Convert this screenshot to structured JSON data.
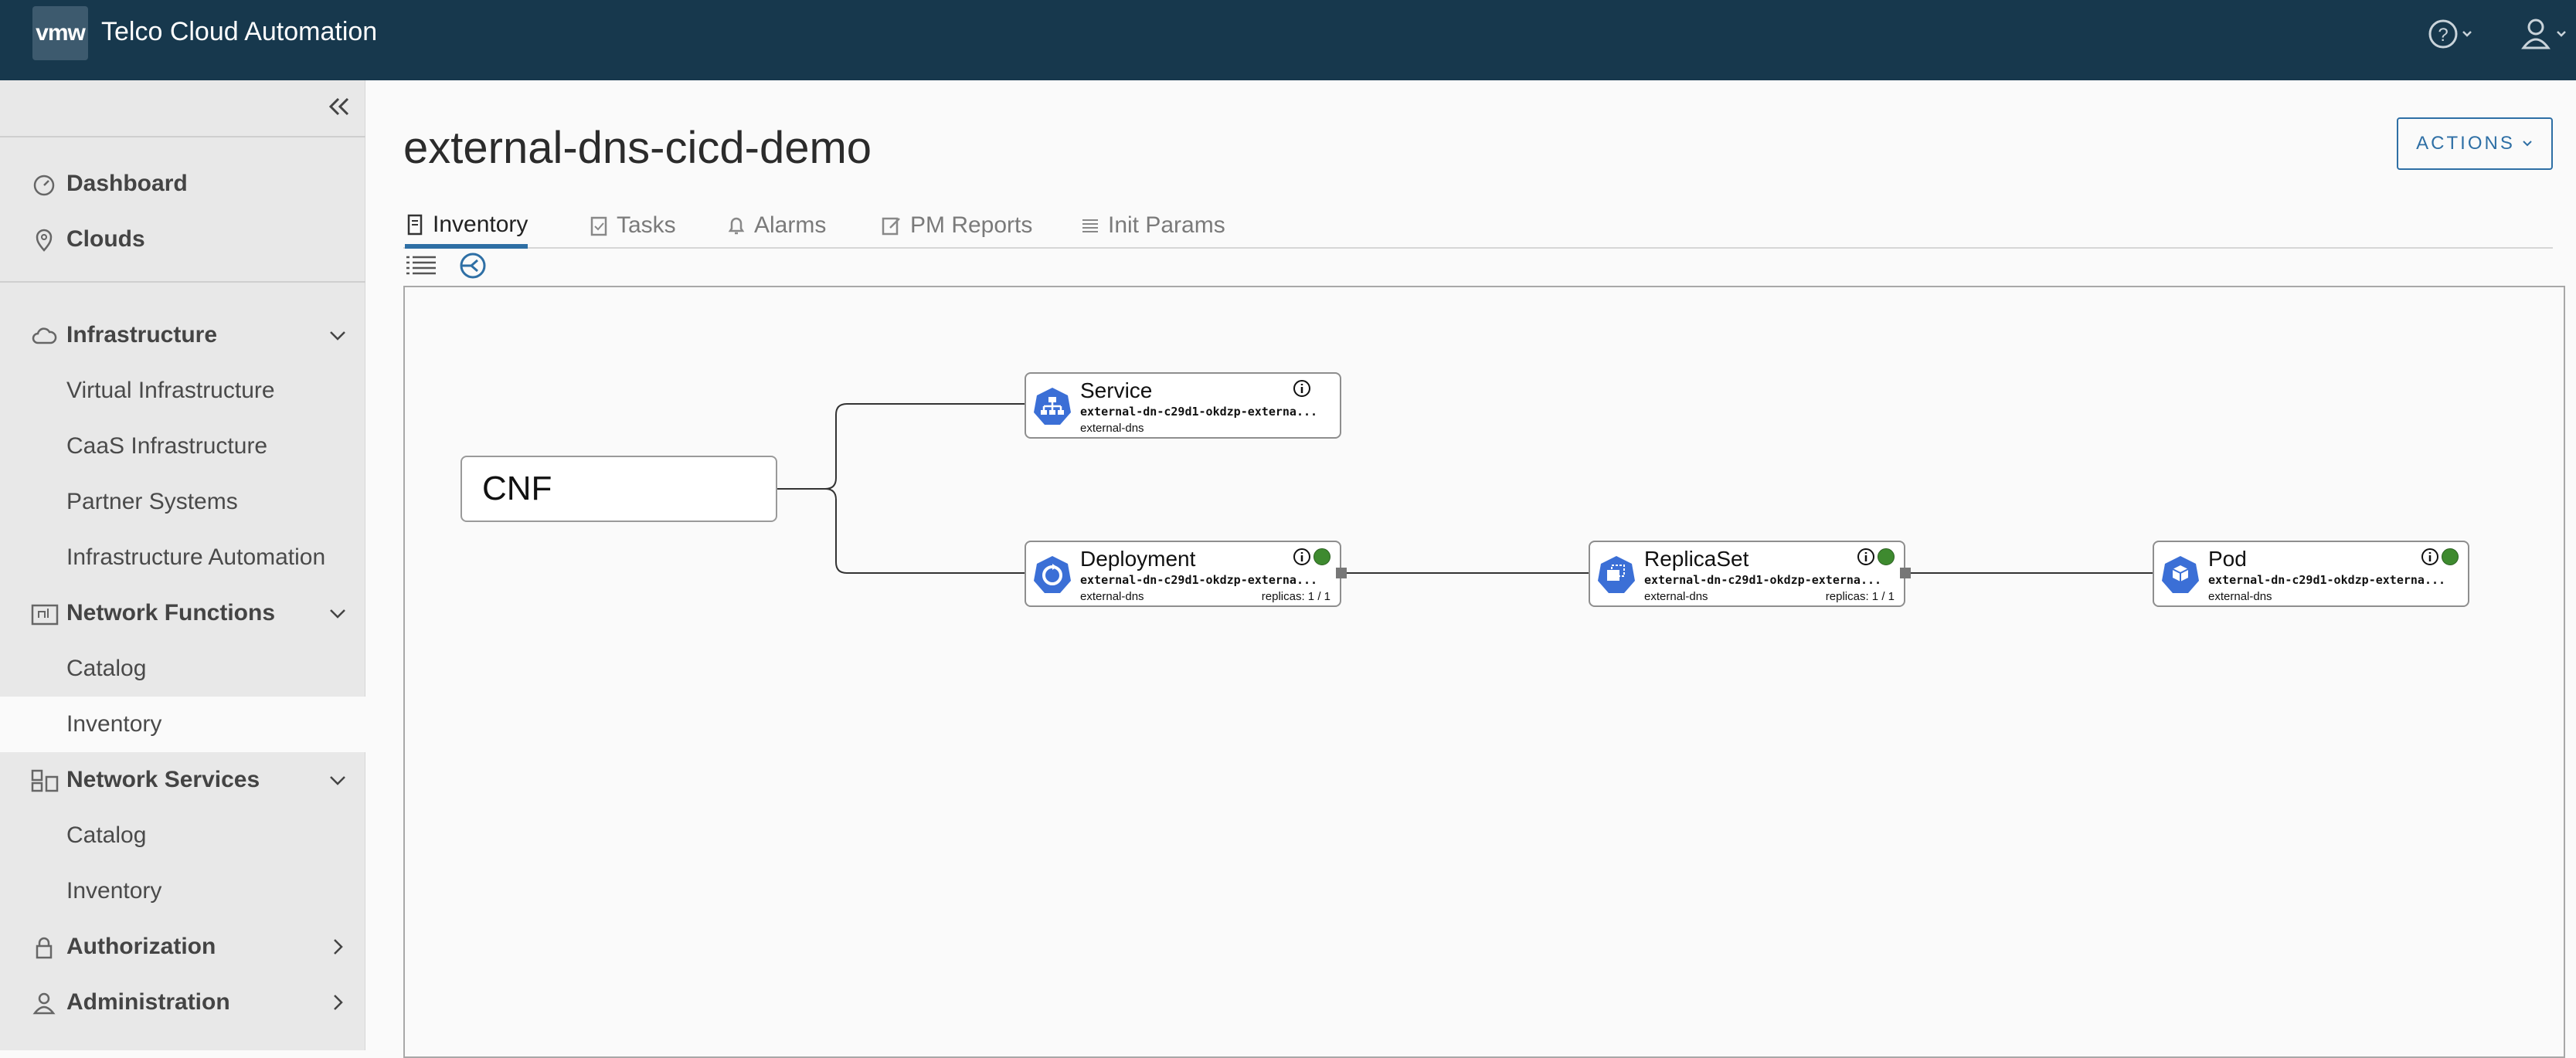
{
  "header": {
    "logo": "vmw",
    "title": "Telco Cloud Automation",
    "help_icon": "help-circle-icon",
    "user_icon": "user-icon"
  },
  "sidebar": {
    "dashboard": "Dashboard",
    "clouds": "Clouds",
    "infrastructure": "Infrastructure",
    "virtual_infrastructure": "Virtual Infrastructure",
    "caas_infrastructure": "CaaS Infrastructure",
    "partner_systems": "Partner Systems",
    "infrastructure_automation": "Infrastructure Automation",
    "network_functions": "Network Functions",
    "nf_catalog": "Catalog",
    "nf_inventory": "Inventory",
    "network_services": "Network Services",
    "ns_catalog": "Catalog",
    "ns_inventory": "Inventory",
    "authorization": "Authorization",
    "administration": "Administration",
    "active_item": "nf_inventory"
  },
  "page": {
    "title": "external-dns-cicd-demo",
    "actions_label": "ACTIONS"
  },
  "tabs": {
    "inventory": "Inventory",
    "tasks": "Tasks",
    "alarms": "Alarms",
    "pm_reports": "PM Reports",
    "init_params": "Init Params",
    "active": "inventory"
  },
  "topology": {
    "root": "CNF",
    "service": {
      "kind": "Service",
      "name": "external-dn-c29d1-okdzp-externa...",
      "namespace": "external-dns"
    },
    "deployment": {
      "kind": "Deployment",
      "name": "external-dn-c29d1-okdzp-externa...",
      "namespace": "external-dns",
      "replicas": "replicas: 1 / 1",
      "status_color": "#3e8a2f"
    },
    "replicaset": {
      "kind": "ReplicaSet",
      "name": "external-dn-c29d1-okdzp-externa...",
      "namespace": "external-dns",
      "replicas": "replicas: 1 / 1",
      "status_color": "#3e8a2f"
    },
    "pod": {
      "kind": "Pod",
      "name": "external-dn-c29d1-okdzp-externa...",
      "namespace": "external-dns",
      "status_color": "#3e8a2f"
    }
  },
  "colors": {
    "header_bg": "#17384d",
    "accent": "#2e6fa5",
    "k8s_icon": "#3b6fd6",
    "status_ok": "#3e8a2f"
  }
}
